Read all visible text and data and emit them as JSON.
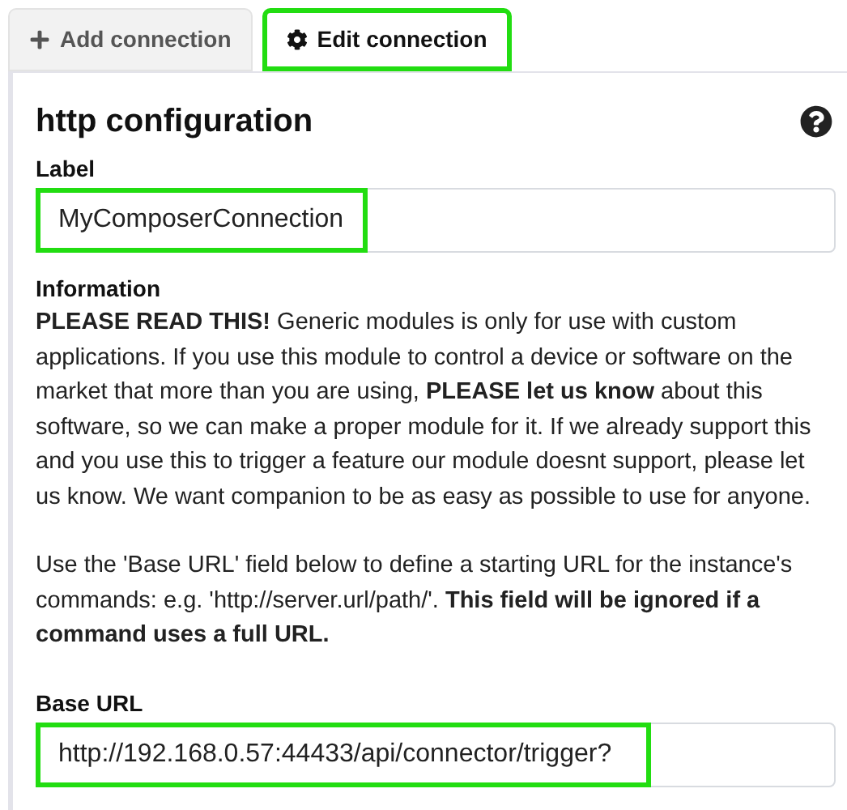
{
  "tabs": [
    {
      "label": "Add connection",
      "kind": "add",
      "selected": false,
      "highlighted": false
    },
    {
      "label": "Edit connection",
      "kind": "edit",
      "selected": true,
      "highlighted": true
    }
  ],
  "heading": "http configuration",
  "fields_top": [
    {
      "label": "Label",
      "value": "MyComposerConnection",
      "highlighted": true
    }
  ],
  "information": {
    "title": "Information",
    "paragraphs": [
      "**PLEASE READ THIS!** Generic modules is only for use with custom applications. If you use this module to control a device or software on the market that more than you are using, **PLEASE let us know** about this software, so we can make a proper module for it. If we already support this and you use this to trigger a feature our module doesnt support, please let us know. We want companion to be as easy as possible to use for anyone.",
      "Use the 'Base URL' field below to define a starting URL for the instance's commands: e.g. 'http://server.url/path/'. **This field will be ignored if a command uses a full URL.**"
    ]
  },
  "fields_bottom": [
    {
      "label": "Base URL",
      "value": "http://192.168.0.57:44433/api/connector/trigger?",
      "highlighted": true
    }
  ]
}
